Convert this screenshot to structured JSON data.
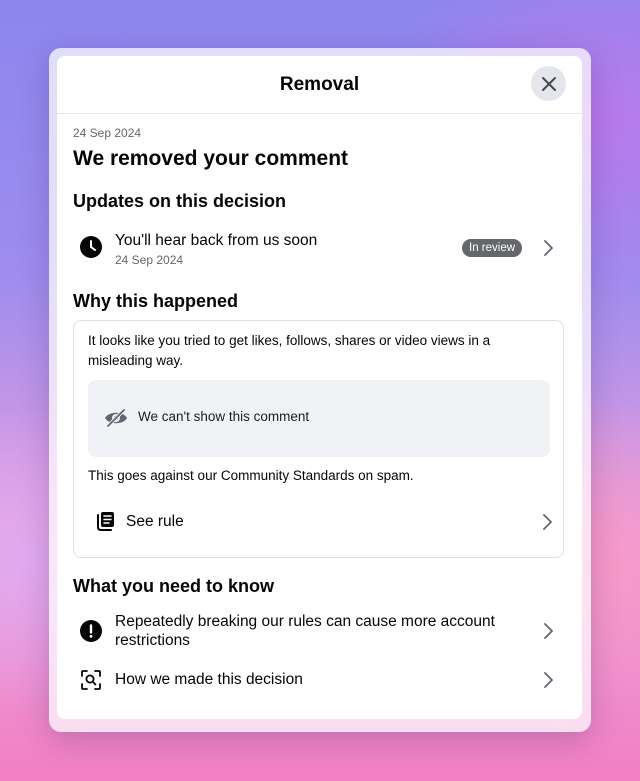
{
  "dialog": {
    "title": "Removal",
    "date": "24 Sep 2024",
    "heading": "We removed your comment"
  },
  "updates": {
    "title": "Updates on this decision",
    "item": {
      "label": "You'll hear back from us soon",
      "date": "24 Sep 2024",
      "status": "In review",
      "icon": "clock-icon"
    }
  },
  "why": {
    "title": "Why this happened",
    "explanation": "It looks like you tried to get likes, follows, shares or video views in a misleading way.",
    "hidden_comment": "We can't show this comment",
    "standards": "This goes against our Community Standards on spam.",
    "see_rule": "See rule"
  },
  "know": {
    "title": "What you need to know",
    "items": [
      {
        "label": "Repeatedly breaking our rules can cause more account restrictions",
        "icon": "exclamation-icon"
      },
      {
        "label": "How we made this decision",
        "icon": "magnify-scan-icon"
      }
    ]
  },
  "colors": {
    "text_primary": "#050505",
    "text_secondary": "#65676b",
    "badge_bg": "#65676b",
    "surface": "#f0f2f5"
  }
}
